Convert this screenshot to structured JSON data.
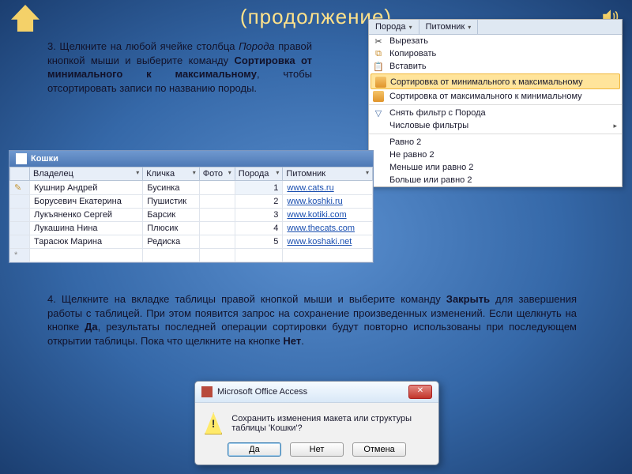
{
  "title": "(продолжение)",
  "para3": {
    "lead": "3. Щелкните на любой ячейке столбца ",
    "col": "Порода",
    "mid": " правой кнопкой мыши и выберите команду ",
    "cmd": "Сортировка от минимального к максимальному",
    "tail": ", чтобы отсортировать записи по названию породы."
  },
  "para4": {
    "lead": "4. Щелкните на вкладке таблицы правой кнопкой мыши и выберите команду ",
    "cmd1": "Закрыть",
    "mid1": " для завершения работы с таблицей. При этом появится запрос на сохранение произведенных изменений. Если щелкнуть на кнопке ",
    "cmd2": "Да",
    "mid2": ", результаты последней операции сортировки будут повторно использованы при последующем открытии таблицы. Пока что щелкните на кнопке ",
    "cmd3": "Нет",
    "tail": "."
  },
  "ctx": {
    "head1": "Порода",
    "head2": "Питомник",
    "items": [
      "Вырезать",
      "Копировать",
      "Вставить",
      "Сортировка от минимального к максимальному",
      "Сортировка от максимального к минимальному",
      "Снять фильтр с Порода",
      "Числовые фильтры",
      "Равно 2",
      "Не равно 2",
      "Меньше или равно 2",
      "Больше или равно 2"
    ]
  },
  "table": {
    "tab": "Кошки",
    "columns": [
      "Владелец",
      "Кличка",
      "Фото",
      "Порода",
      "Питомник"
    ],
    "rows": [
      {
        "owner": "Кушнир Андрей",
        "name": "Бусинка",
        "photo": "",
        "breed": "1",
        "site": "www.cats.ru"
      },
      {
        "owner": "Борусевич Екатерина",
        "name": "Пушистик",
        "photo": "",
        "breed": "2",
        "site": "www.koshki.ru"
      },
      {
        "owner": "Лукъяненко Сергей",
        "name": "Барсик",
        "photo": "",
        "breed": "3",
        "site": "www.kotiki.com"
      },
      {
        "owner": "Лукашина Нина",
        "name": "Плюсик",
        "photo": "",
        "breed": "4",
        "site": "www.thecats.com"
      },
      {
        "owner": "Тарасюк Марина",
        "name": "Редиска",
        "photo": "",
        "breed": "5",
        "site": "www.koshaki.net"
      }
    ],
    "newrow_marker": "*"
  },
  "dialog": {
    "title": "Microsoft Office Access",
    "message": "Сохранить изменения макета или структуры таблицы 'Кошки'?",
    "buttons": {
      "yes": "Да",
      "no": "Нет",
      "cancel": "Отмена"
    },
    "close_glyph": "✕"
  }
}
